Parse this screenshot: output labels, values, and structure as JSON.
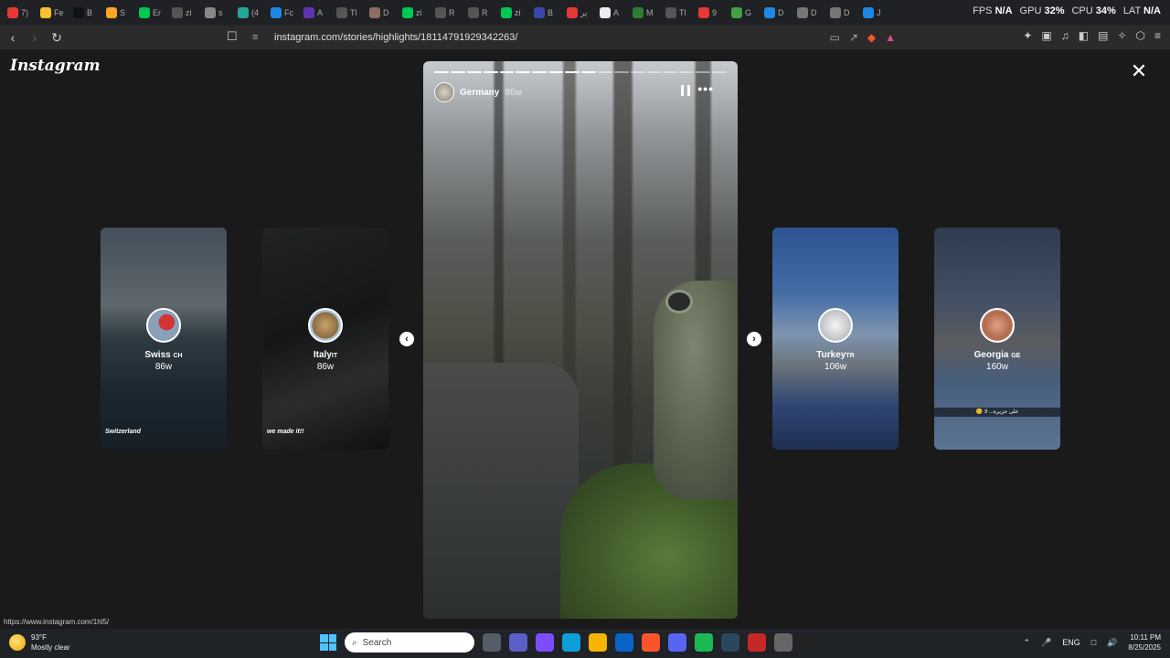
{
  "browser": {
    "tabs": [
      {
        "label": "7)",
        "color": "#e53935"
      },
      {
        "label": "Fe",
        "color": "#fbc02d"
      },
      {
        "label": "B",
        "color": "#111111"
      },
      {
        "label": "S",
        "color": "#f9a825"
      },
      {
        "label": "Er",
        "color": "#00c853"
      },
      {
        "label": "zi",
        "color": "#555555"
      },
      {
        "label": "s",
        "color": "#888888"
      },
      {
        "label": "(4",
        "color": "#26a69a"
      },
      {
        "label": "Fc",
        "color": "#1e88e5"
      },
      {
        "label": "A",
        "color": "#5e35b1"
      },
      {
        "label": "Tl",
        "color": "#555555"
      },
      {
        "label": "D",
        "color": "#8d6e63"
      },
      {
        "label": "zi",
        "color": "#00c853"
      },
      {
        "label": "R",
        "color": "#555555"
      },
      {
        "label": "R",
        "color": "#555555"
      },
      {
        "label": "zi",
        "color": "#00c853"
      },
      {
        "label": "B",
        "color": "#3949ab"
      },
      {
        "label": "ير",
        "color": "#e53935"
      },
      {
        "label": "A",
        "color": "#eeeeee"
      },
      {
        "label": "M",
        "color": "#2e7d32"
      },
      {
        "label": "Tl",
        "color": "#555555"
      },
      {
        "label": "9",
        "color": "#e53935"
      },
      {
        "label": "G",
        "color": "#43a047"
      },
      {
        "label": "D",
        "color": "#1e88e5"
      },
      {
        "label": "D",
        "color": "#777777"
      },
      {
        "label": "D",
        "color": "#777777"
      },
      {
        "label": "J",
        "color": "#1e88e5"
      }
    ],
    "active_tab_label": "S",
    "perf": {
      "fps_label": "FPS",
      "fps_value": "N/A",
      "gpu_label": "GPU",
      "gpu_value": "32%",
      "cpu_label": "CPU",
      "cpu_value": "34%",
      "lat_label": "LAT",
      "lat_value": "N/A"
    },
    "url": "instagram.com/stories/highlights/18114791929342263/",
    "status_url": "https://www.instagram.com/1hl5/"
  },
  "page": {
    "logo": "Instagram",
    "main_story": {
      "title": "Germany",
      "time": "86w",
      "progress_segments": 18,
      "progress_done": 10
    },
    "side_stories": [
      {
        "name": "Swiss",
        "flag_code": "CH",
        "age": "86w",
        "caption": "Switzerland",
        "caption_type": "script"
      },
      {
        "name": "Italy",
        "flag_code": "IT",
        "age": "86w",
        "caption": "we made it!!",
        "caption_type": "script"
      },
      {
        "name": "Turkey",
        "flag_code": "TR",
        "age": "106w",
        "caption": "",
        "caption_type": "none"
      },
      {
        "name": "Georgia",
        "flag_code": "GE",
        "age": "160w",
        "caption": "😊 على جزيرة... لا",
        "caption_type": "bar"
      }
    ]
  },
  "taskbar": {
    "weather": {
      "temp": "93°F",
      "condition": "Mostly clear"
    },
    "search_placeholder": "Search",
    "apps": [
      {
        "name": "file-explorer",
        "color": "#555d66"
      },
      {
        "name": "teams",
        "color": "#5b5fc7"
      },
      {
        "name": "copilot",
        "color": "#7c4dff"
      },
      {
        "name": "edge",
        "color": "#0f9fd8"
      },
      {
        "name": "folder",
        "color": "#f4b400"
      },
      {
        "name": "outlook",
        "color": "#0a64c8"
      },
      {
        "name": "brave",
        "color": "#fb542b"
      },
      {
        "name": "discord",
        "color": "#5865f2"
      },
      {
        "name": "spotify",
        "color": "#1db954"
      },
      {
        "name": "steam",
        "color": "#2a475e"
      },
      {
        "name": "news",
        "color": "#c62828"
      },
      {
        "name": "settings",
        "color": "#666666"
      },
      {
        "name": "obs",
        "color": "#222222"
      }
    ],
    "tray": {
      "language": "ENG",
      "time": "10:11 PM",
      "date": "8/25/2025"
    }
  }
}
